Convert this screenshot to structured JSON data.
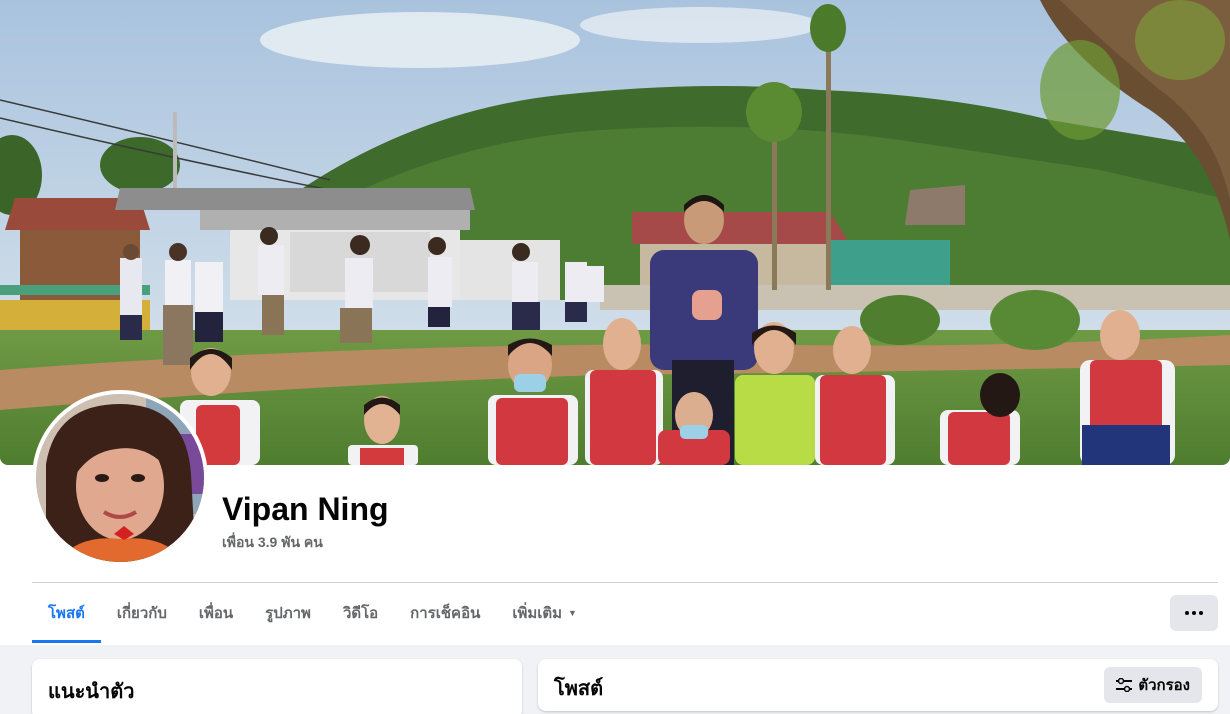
{
  "profile": {
    "name": "Vipan Ning",
    "friends_count": "เพื่อน 3.9 พัน คน"
  },
  "tabs": [
    {
      "label": "โพสต์",
      "active": true
    },
    {
      "label": "เกี่ยวกับ"
    },
    {
      "label": "เพื่อน"
    },
    {
      "label": "รูปภาพ"
    },
    {
      "label": "วิดีโอ"
    },
    {
      "label": "การเช็คอิน"
    },
    {
      "label": "เพิ่มเติม"
    }
  ],
  "intro": {
    "title": "แนะนำตัว"
  },
  "posts": {
    "title": "โพสต์",
    "filter_label": "ตัวกรอง"
  },
  "icons": {
    "more": "more-icon",
    "filter": "filter-icon",
    "caret": "caret-down-icon"
  },
  "colors": {
    "accent": "#1877f2",
    "background": "#f0f2f5",
    "button": "#e4e6eb",
    "secondary_text": "#65676b"
  }
}
